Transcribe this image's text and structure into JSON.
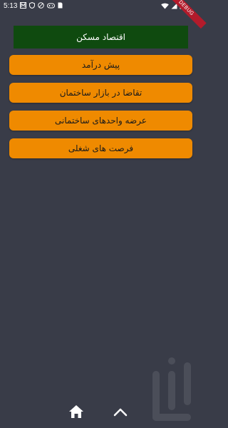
{
  "status_bar": {
    "time": "5:13",
    "icons_left": [
      "m-icon",
      "shield-icon",
      "vpn-icon",
      "gamepad-icon",
      "sim-icon"
    ],
    "icons_right": [
      "wifi-icon",
      "signal-icon",
      "battery-icon"
    ]
  },
  "debug_banner": "DEBUG",
  "page": {
    "title": "اقتصاد مسکن"
  },
  "menu": {
    "items": [
      {
        "label": "پیش درآمد"
      },
      {
        "label": "تقاضا در بازار ساختمان"
      },
      {
        "label": "عرضه واحدهای ساختمانی"
      },
      {
        "label": "فرصت های شغلی"
      }
    ]
  },
  "bottom_nav": {
    "icons": [
      "home-icon",
      "chevron-up-icon"
    ]
  },
  "colors": {
    "background": "#393c48",
    "title_bg": "#0f4a0f",
    "button_bg": "#ef8a00",
    "button_text": "#1a1a1a"
  }
}
